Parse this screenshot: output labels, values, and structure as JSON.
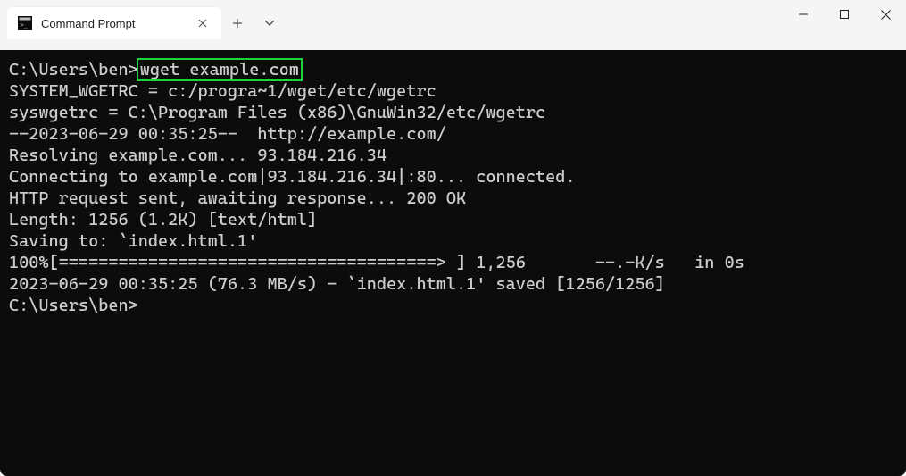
{
  "tab": {
    "title": "Command Prompt"
  },
  "terminal": {
    "line1_prompt": "C:\\Users\\ben>",
    "line1_cmd": "wget example.com",
    "line2": "SYSTEM_WGETRC = c:/progra~1/wget/etc/wgetrc",
    "line3": "syswgetrc = C:\\Program Files (x86)\\GnuWin32/etc/wgetrc",
    "line4": "--2023-06-29 00:35:25--  http://example.com/",
    "line5": "Resolving example.com... 93.184.216.34",
    "line6": "Connecting to example.com|93.184.216.34|:80... connected.",
    "line7": "HTTP request sent, awaiting response... 200 OK",
    "line8": "Length: 1256 (1.2K) [text/html]",
    "line9": "Saving to: `index.html.1'",
    "blank1": "",
    "line10": "100%[======================================> ] 1,256       --.-K/s   in 0s",
    "blank2": "",
    "line11": "2023-06-29 00:35:25 (76.3 MB/s) - `index.html.1' saved [1256/1256]",
    "blank3": "",
    "blank4": "",
    "line12": "C:\\Users\\ben>"
  }
}
